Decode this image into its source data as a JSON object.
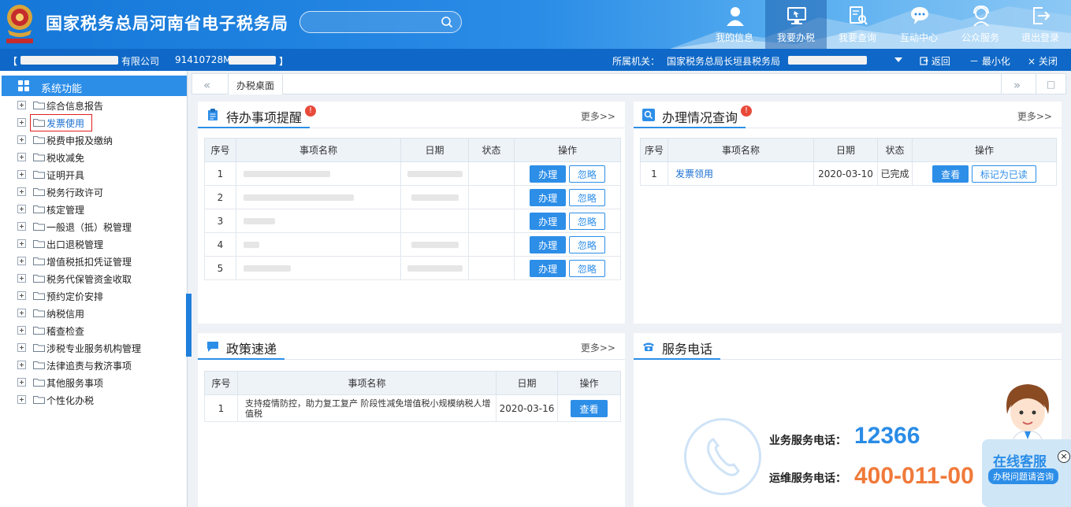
{
  "header": {
    "title": "国家税务总局河南省电子税务局",
    "search_placeholder": "",
    "nav": [
      {
        "label": "我的信息",
        "icon": "user-icon"
      },
      {
        "label": "我要办税",
        "icon": "monitor-icon",
        "active": true
      },
      {
        "label": "我要查询",
        "icon": "document-search-icon"
      },
      {
        "label": "互动中心",
        "icon": "chat-icon"
      },
      {
        "label": "公众服务",
        "icon": "service-person-icon"
      },
      {
        "label": "退出登录",
        "icon": "logout-icon"
      }
    ]
  },
  "infobar": {
    "bracket_open": "【",
    "company_suffix": "有限公司",
    "tax_id": "91410728M",
    "bracket_close": "】",
    "org_label": "所属机关：",
    "org_name": "国家税务总局长垣县税务局",
    "back": "返回",
    "minimize": "最小化",
    "close": "关闭"
  },
  "sidebar": {
    "header": "系统功能",
    "items": [
      {
        "label": "综合信息报告"
      },
      {
        "label": "发票使用",
        "selected": true
      },
      {
        "label": "税费申报及缴纳"
      },
      {
        "label": "税收减免"
      },
      {
        "label": "证明开具"
      },
      {
        "label": "税务行政许可"
      },
      {
        "label": "核定管理"
      },
      {
        "label": "一般退（抵）税管理"
      },
      {
        "label": "出口退税管理"
      },
      {
        "label": "增值税抵扣凭证管理"
      },
      {
        "label": "税务代保管资金收取"
      },
      {
        "label": "预约定价安排"
      },
      {
        "label": "纳税信用"
      },
      {
        "label": "稽查检查"
      },
      {
        "label": "涉税专业服务机构管理"
      },
      {
        "label": "法律追责与救济事项"
      },
      {
        "label": "其他服务事项"
      },
      {
        "label": "个性化办税"
      }
    ]
  },
  "tabs": {
    "left_arrow": "«",
    "right_arrow": "»",
    "restore": "□",
    "active": "办税桌面"
  },
  "todo": {
    "title": "待办事项提醒",
    "more": "更多>>",
    "columns": [
      "序号",
      "事项名称",
      "日期",
      "状态",
      "操作"
    ],
    "rows": [
      {
        "no": "1"
      },
      {
        "no": "2"
      },
      {
        "no": "3"
      },
      {
        "no": "4"
      },
      {
        "no": "5"
      }
    ],
    "btn_handle": "办理",
    "btn_ignore": "忽略"
  },
  "status_query": {
    "title": "办理情况查询",
    "more": "更多>>",
    "columns": [
      "序号",
      "事项名称",
      "日期",
      "状态",
      "操作"
    ],
    "rows": [
      {
        "no": "1",
        "name": "发票领用",
        "date": "2020-03-10",
        "status": "已完成"
      }
    ],
    "btn_view": "查看",
    "btn_mark": "标记为已读"
  },
  "policy": {
    "title": "政策速递",
    "more": "更多>>",
    "columns": [
      "序号",
      "事项名称",
      "日期",
      "操作"
    ],
    "rows": [
      {
        "no": "1",
        "name": "支持疫情防控，助力复工复产 阶段性减免增值税小规模纳税人增值税",
        "date": "2020-03-16"
      }
    ],
    "btn_view": "查看"
  },
  "service_phone": {
    "title": "服务电话",
    "business_label": "业务服务电话：",
    "business_number": "12366",
    "ops_label": "运维服务电话：",
    "ops_number": "400-011-00"
  },
  "kefu": {
    "title": "在线客服",
    "subtitle": "办税问题请咨询",
    "close": "×"
  },
  "colors": {
    "primary": "#2d8ee8",
    "header_dark": "#0f68c7",
    "phone_blue": "#2a8ce6",
    "phone_orange": "#f07a3a",
    "badge_red": "#e84a3a"
  }
}
